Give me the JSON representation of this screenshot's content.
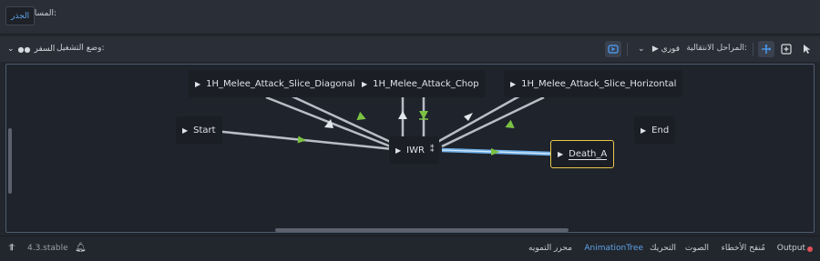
{
  "topbar": {
    "path_label": "المسار:",
    "root_button": "الجذر"
  },
  "toolbar": {
    "select_icon": "arrow-cursor-icon",
    "add_icon": "add-node-icon",
    "move_icon": "move-icon",
    "transition_label": "المراحل الانتقالية:",
    "transition_value": "▶ فوري",
    "play_mode_label": "وضع التشغيل:",
    "play_mode_value": "السفر"
  },
  "graph": {
    "nodes": [
      {
        "id": "start",
        "label": "Start"
      },
      {
        "id": "end",
        "label": "End"
      },
      {
        "id": "slice_diagonal",
        "label": "1H_Melee_Attack_Slice_Diagonal"
      },
      {
        "id": "chop",
        "label": "1H_Melee_Attack_Chop"
      },
      {
        "id": "slice_horizontal",
        "label": "1H_Melee_Attack_Slice_Horizontal"
      },
      {
        "id": "iwr",
        "label": "IWR"
      },
      {
        "id": "death_a",
        "label": "Death_A",
        "selected": true
      }
    ],
    "accent_color": "#e8c84a",
    "active_transition_color": "#6fb0e8",
    "transition_arrow_color": "#7cc242"
  },
  "bottombar": {
    "output": "Output",
    "debugger": "مُنقح الأخطاء",
    "audio": "الصوت",
    "animation": "التحريك",
    "animation_tree": "AnimationTree",
    "shader_editor": "محرر التمويه",
    "version": "4.3.stable"
  }
}
